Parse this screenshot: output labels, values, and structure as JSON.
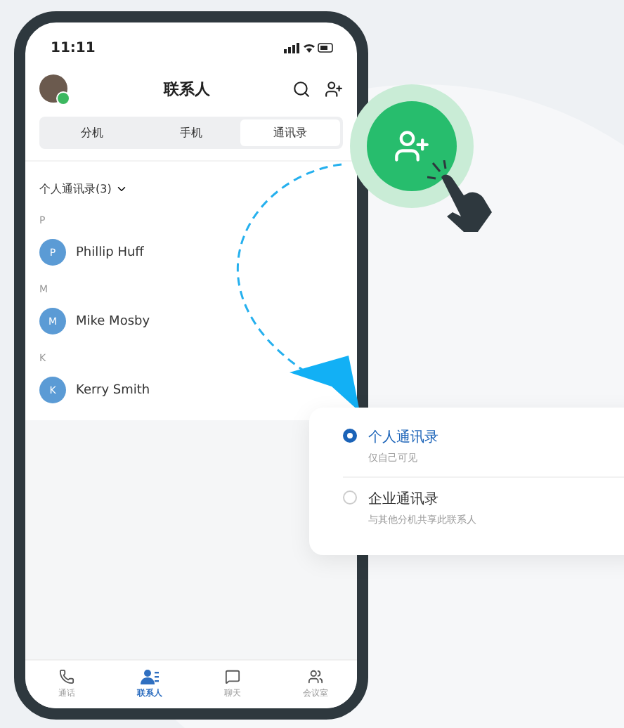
{
  "status_bar": {
    "time": "11:11"
  },
  "header": {
    "title": "联系人"
  },
  "tabs": [
    {
      "label": "分机",
      "selected": false
    },
    {
      "label": "手机",
      "selected": false
    },
    {
      "label": "通讯录",
      "selected": true
    }
  ],
  "group": {
    "label": "个人通讯录(3)"
  },
  "sections": [
    {
      "letter": "P",
      "contacts": [
        {
          "initial": "P",
          "name": "Phillip Huff"
        }
      ]
    },
    {
      "letter": "M",
      "contacts": [
        {
          "initial": "M",
          "name": "Mike Mosby"
        }
      ]
    },
    {
      "letter": "K",
      "contacts": [
        {
          "initial": "K",
          "name": "Kerry Smith"
        }
      ]
    }
  ],
  "bottom_nav": [
    {
      "kind": "calls",
      "label": "通话",
      "selected": false
    },
    {
      "kind": "contacts",
      "label": "联系人",
      "selected": true
    },
    {
      "kind": "chat",
      "label": "聊天",
      "selected": false
    },
    {
      "kind": "meeting",
      "label": "会议室",
      "selected": false
    }
  ],
  "popup": {
    "options": [
      {
        "title": "个人通讯录",
        "subtitle": "仅自己可见",
        "selected": true
      },
      {
        "title": "企业通讯录",
        "subtitle": "与其他分机共享此联系人",
        "selected": false
      }
    ]
  }
}
